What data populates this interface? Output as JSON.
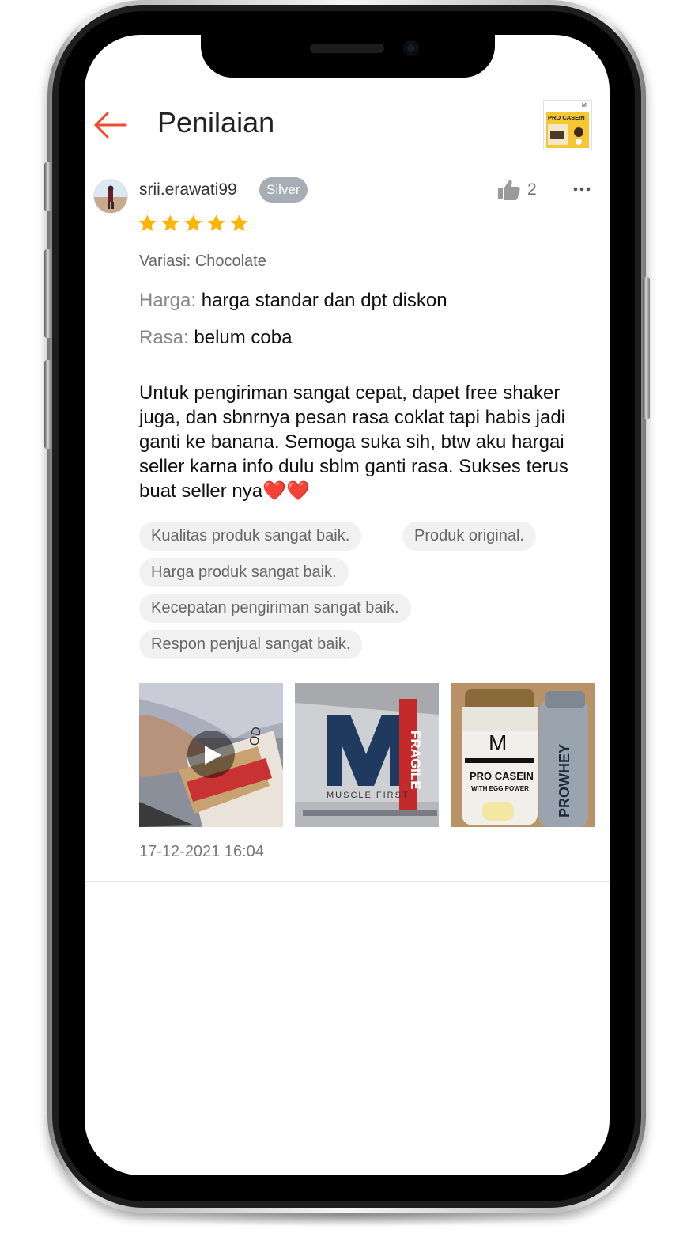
{
  "header": {
    "title": "Penilaian",
    "product_thumb_text": "PRO CASEIN"
  },
  "review": {
    "username": "srii.erawati99",
    "badge": "Silver",
    "likes": "2",
    "rating": 5,
    "variant": "Variasi: Chocolate",
    "attributes": [
      {
        "key": "Harga:",
        "value": "harga standar dan dpt diskon"
      },
      {
        "key": "Rasa:",
        "value": "belum coba"
      }
    ],
    "text": "Untuk pengiriman sangat cepat, dapet free shaker juga, dan sbnrnya pesan rasa coklat tapi habis jadi ganti ke banana. Semoga suka sih, btw aku hargai seller karna info dulu sblm ganti rasa. Sukses terus buat seller nya",
    "hearts": "❤️❤️",
    "tags": [
      "Kualitas produk sangat baik.",
      "Produk original.",
      "Harga produk sangat baik.",
      "Kecepatan pengiriman sangat baik.",
      "Respon penjual sangat baik."
    ],
    "media": [
      {
        "type": "video",
        "caption": ""
      },
      {
        "type": "image",
        "label_main": "M",
        "label_sub": "MUSCLE FIRST",
        "label_side": "FRAGILE"
      },
      {
        "type": "image",
        "label_main": "M",
        "label_sub": "PRO CASEIN",
        "label_small": "WITH EGG POWER",
        "label_side": "PROWHEY"
      }
    ],
    "timestamp": "17-12-2021 16:04"
  },
  "colors": {
    "accent": "#ee4d2d",
    "star": "#ffb400",
    "badge": "#a7adb5"
  }
}
